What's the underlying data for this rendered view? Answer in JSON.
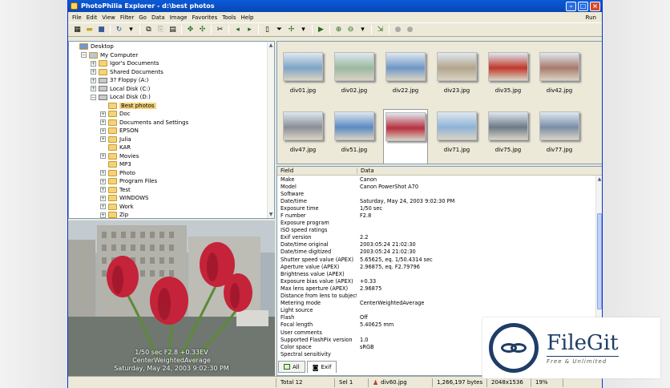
{
  "window": {
    "title": "PhotoPhilia Explorer - d:\\best photos"
  },
  "menu": [
    "File",
    "Edit",
    "View",
    "Filter",
    "Go",
    "Data",
    "Image",
    "Favorites",
    "Tools",
    "Help"
  ],
  "run_label": "Run",
  "tree": [
    {
      "label": "Desktop",
      "indent": 0,
      "exp": "",
      "icon": "desktop"
    },
    {
      "label": "My Computer",
      "indent": 1,
      "exp": "-",
      "icon": "computer"
    },
    {
      "label": "Igor's Documents",
      "indent": 2,
      "exp": "+",
      "icon": "folder"
    },
    {
      "label": "Shared Documents",
      "indent": 2,
      "exp": "+",
      "icon": "folder"
    },
    {
      "label": "3? Floppy (A:)",
      "indent": 2,
      "exp": "+",
      "icon": "drive"
    },
    {
      "label": "Local Disk (C:)",
      "indent": 2,
      "exp": "+",
      "icon": "drive"
    },
    {
      "label": "Local Disk (D:)",
      "indent": 2,
      "exp": "-",
      "icon": "drive"
    },
    {
      "label": "Best photos",
      "indent": 3,
      "exp": "",
      "icon": "folder",
      "selected": true
    },
    {
      "label": "Doc",
      "indent": 3,
      "exp": "+",
      "icon": "folder"
    },
    {
      "label": "Documents and Settings",
      "indent": 3,
      "exp": "+",
      "icon": "folder"
    },
    {
      "label": "EPSON",
      "indent": 3,
      "exp": "+",
      "icon": "folder"
    },
    {
      "label": "Julia",
      "indent": 3,
      "exp": "+",
      "icon": "folder"
    },
    {
      "label": "KAR",
      "indent": 3,
      "exp": "",
      "icon": "folder"
    },
    {
      "label": "Movies",
      "indent": 3,
      "exp": "+",
      "icon": "folder"
    },
    {
      "label": "MP3",
      "indent": 3,
      "exp": "",
      "icon": "folder"
    },
    {
      "label": "Photo",
      "indent": 3,
      "exp": "+",
      "icon": "folder"
    },
    {
      "label": "Program Files",
      "indent": 3,
      "exp": "+",
      "icon": "folder"
    },
    {
      "label": "Test",
      "indent": 3,
      "exp": "+",
      "icon": "folder"
    },
    {
      "label": "WINDOWS",
      "indent": 3,
      "exp": "+",
      "icon": "folder"
    },
    {
      "label": "Work",
      "indent": 3,
      "exp": "+",
      "icon": "folder"
    },
    {
      "label": "Zip",
      "indent": 3,
      "exp": "+",
      "icon": "folder"
    }
  ],
  "preview": {
    "line1": "1/50 sec   F2.8   +0.33EV",
    "line2": "CenterWeightedAverage",
    "line3": "Saturday, May 24, 2003 9:02:30 PM"
  },
  "thumbnails": [
    {
      "name": "div01.jpg",
      "tone": "#7da4c6"
    },
    {
      "name": "div02.jpg",
      "tone": "#9bb8a0"
    },
    {
      "name": "div22.jpg",
      "tone": "#6f97c7"
    },
    {
      "name": "div23.jpg",
      "tone": "#b3a58c"
    },
    {
      "name": "div35.jpg",
      "tone": "#c0392b"
    },
    {
      "name": "div42.jpg",
      "tone": "#a97a6c"
    },
    {
      "name": "div47.jpg",
      "tone": "#8a8f97"
    },
    {
      "name": "div51.jpg",
      "tone": "#5b8ac2"
    },
    {
      "name": "",
      "tone": "#b7303d",
      "selected": true
    },
    {
      "name": "div71.jpg",
      "tone": "#8fb3d6"
    },
    {
      "name": "div75.jpg",
      "tone": "#6d7a88"
    },
    {
      "name": "div77.jpg",
      "tone": "#7a8ea6"
    }
  ],
  "exif": {
    "headers": [
      "Field",
      "Data"
    ],
    "rows": [
      [
        "Make",
        "Canon"
      ],
      [
        "Model",
        "Canon PowerShot A70"
      ],
      [
        "Software",
        ""
      ],
      [
        "Date/time",
        "Saturday, May 24, 2003 9:02:30 PM"
      ],
      [
        "Exposure time",
        "1/50 sec"
      ],
      [
        "F number",
        "F2.8"
      ],
      [
        "Exposure program",
        ""
      ],
      [
        "ISO speed ratings",
        ""
      ],
      [
        "Exif version",
        "2.2"
      ],
      [
        "Date/time original",
        "2003:05:24 21:02:30"
      ],
      [
        "Date/time digitized",
        "2003:05:24 21:02:30"
      ],
      [
        "Shutter speed value (APEX)",
        "5.65625, eq. 1/50.4314 sec"
      ],
      [
        "Aperture value (APEX)",
        "2.96875, eq. F2.79796"
      ],
      [
        "Brightness value (APEX)",
        ""
      ],
      [
        "Exposure bias value (APEX)",
        "+0.33"
      ],
      [
        "Max lens aperture (APEX)",
        "2.96875"
      ],
      [
        "Distance from lens to subject",
        ""
      ],
      [
        "Metering mode",
        "CenterWeightedAverage"
      ],
      [
        "Light source",
        ""
      ],
      [
        "Flash",
        "Off"
      ],
      [
        "Focal length",
        "5.40625 mm"
      ],
      [
        "User comments",
        ""
      ],
      [
        "Supported FlashPix version",
        "1.0"
      ],
      [
        "Color space",
        "sRGB"
      ],
      [
        "Spectral sensitivity",
        ""
      ]
    ]
  },
  "tabs": [
    "All",
    "Exif"
  ],
  "status": {
    "total": "Total 12",
    "sel": "Sel 1",
    "file": "div60.jpg",
    "size": "1,266,197 bytes",
    "dims": "2048x1536",
    "zoom": "19%"
  },
  "watermark": {
    "title": "FileGit",
    "subtitle": "Free & Unlimited"
  }
}
